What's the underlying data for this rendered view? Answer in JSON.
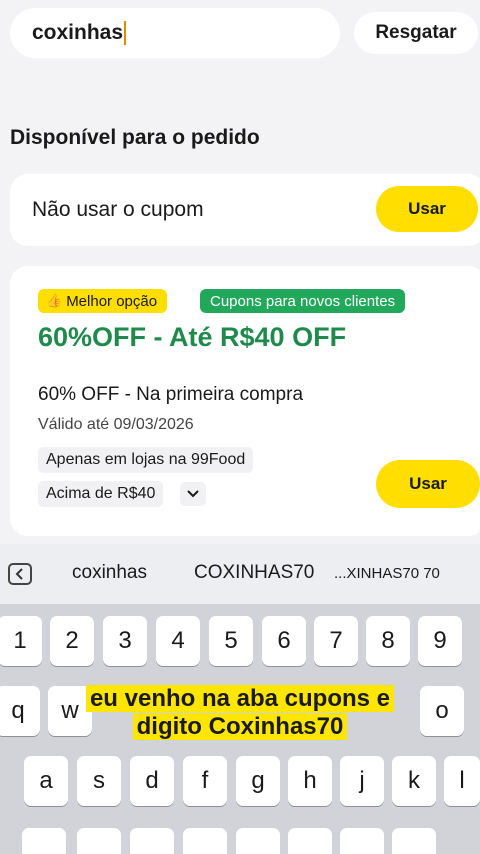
{
  "header": {
    "code_input_value": "coxinhas",
    "redeem_label": "Resgatar"
  },
  "section": {
    "title": "Disponível para o pedido"
  },
  "no_coupon": {
    "label": "Não usar o cupom",
    "use_label": "Usar"
  },
  "coupon": {
    "best_badge": "Melhor opção",
    "new_badge": "Cupons para novos clientes",
    "headline": "60%OFF - Até R$40 OFF",
    "description": "60% OFF - Na primeira compra",
    "validity": "Válido até 09/03/2026",
    "condition_stores": "Apenas em lojas na 99Food",
    "condition_min": "Acima de R$40",
    "use_label": "Usar"
  },
  "keyboard": {
    "suggestions": [
      "coxinhas",
      "COXINHAS70",
      "...XINHAS70 70"
    ],
    "row_numbers": [
      "1",
      "2",
      "3",
      "4",
      "5",
      "6",
      "7",
      "8",
      "9"
    ],
    "row_qwerty_visible": [
      "q",
      "w",
      "o"
    ],
    "row_home": [
      "a",
      "s",
      "d",
      "f",
      "g",
      "h",
      "j",
      "k",
      "l"
    ]
  },
  "caption": {
    "line1": "eu venho na aba cupons e",
    "line2": "digito Coxinhas70"
  },
  "colors": {
    "accent_yellow": "#ffde00",
    "promo_green": "#1f8a4c",
    "badge_green": "#22a85a"
  }
}
